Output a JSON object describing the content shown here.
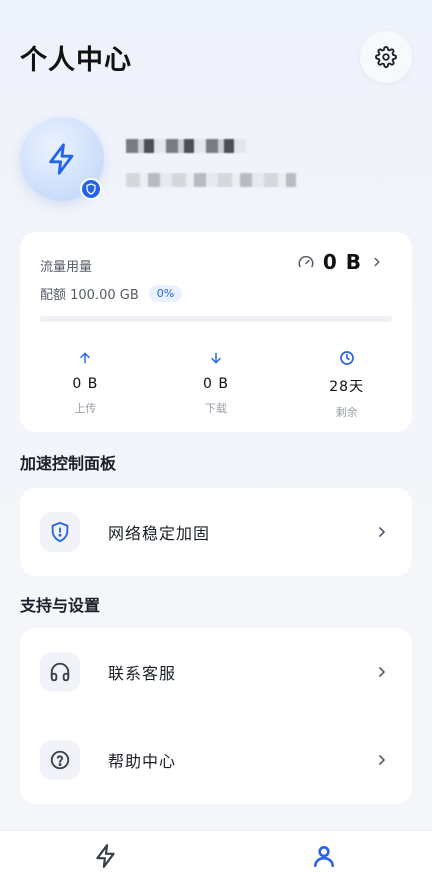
{
  "header": {
    "title": "个人中心",
    "settings_icon": "gear-icon"
  },
  "profile": {
    "avatar_icon": "lightning-icon",
    "badge_icon": "shield-icon"
  },
  "usage": {
    "label": "流量用量",
    "used": "0 B",
    "quota": "配额 100.00 GB",
    "percent_text": "0%",
    "percent": 0,
    "stats": [
      {
        "icon": "arrow-up-icon",
        "value": "0 B",
        "label": "上传"
      },
      {
        "icon": "arrow-down-icon",
        "value": "0 B",
        "label": "下载"
      },
      {
        "icon": "clock-icon",
        "value": "28天",
        "label": "剩余"
      }
    ]
  },
  "sections": {
    "acceleration_title": "加速控制面板",
    "support_title": "支持与设置"
  },
  "acceleration": {
    "item_label": "网络稳定加固",
    "item_icon": "shield-alert-icon"
  },
  "support": {
    "items": [
      {
        "label": "联系客服",
        "icon": "headset-icon"
      },
      {
        "label": "帮助中心",
        "icon": "help-circle-icon"
      }
    ]
  },
  "bottom_nav": {
    "items": [
      {
        "icon": "lightning-icon",
        "active": false
      },
      {
        "icon": "user-icon",
        "active": true
      }
    ]
  },
  "colors": {
    "accent": "#2563eb",
    "background": "#f3f5fa"
  }
}
